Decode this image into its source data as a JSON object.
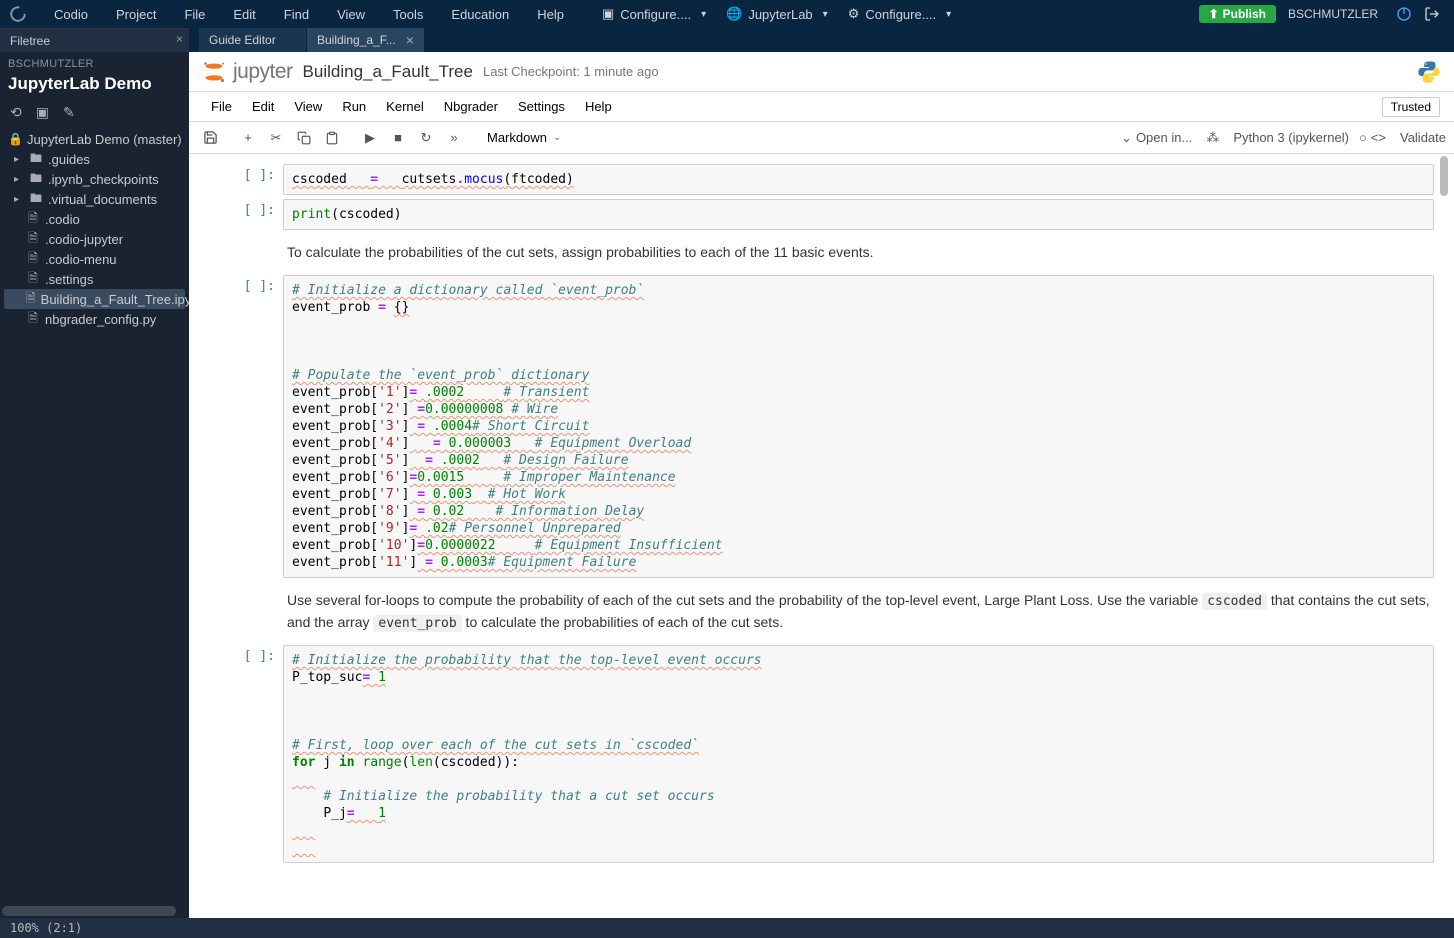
{
  "topbar": {
    "menus": [
      "Codio",
      "Project",
      "File",
      "Edit",
      "Find",
      "View",
      "Tools",
      "Education",
      "Help"
    ],
    "configs": [
      {
        "icon": "terminal",
        "label": "Configure...."
      },
      {
        "icon": "globe",
        "label": "JupyterLab"
      },
      {
        "icon": "gear",
        "label": "Configure...."
      }
    ],
    "publish": "Publish",
    "user": "BSCHMUTZLER"
  },
  "sidebar": {
    "tab": "Filetree",
    "user": "BSCHMUTZLER",
    "project": "JupyterLab Demo",
    "root": "JupyterLab Demo (master)",
    "items": [
      {
        "type": "folder",
        "name": ".guides"
      },
      {
        "type": "folder",
        "name": ".ipynb_checkpoints"
      },
      {
        "type": "folder",
        "name": ".virtual_documents"
      },
      {
        "type": "file",
        "name": ".codio"
      },
      {
        "type": "file",
        "name": ".codio-jupyter"
      },
      {
        "type": "file",
        "name": ".codio-menu"
      },
      {
        "type": "file",
        "name": ".settings"
      },
      {
        "type": "file",
        "name": "Building_a_Fault_Tree.ipynb",
        "active": true
      },
      {
        "type": "file",
        "name": "nbgrader_config.py"
      }
    ]
  },
  "tabs": [
    {
      "label": "Guide Editor",
      "active": false,
      "closeable": false
    },
    {
      "label": "Building_a_F...",
      "active": true,
      "closeable": true
    }
  ],
  "jupyter": {
    "logo_text": "jupyter",
    "notebook_name": "Building_a_Fault_Tree",
    "checkpoint": "Last Checkpoint: 1 minute ago",
    "menus": [
      "File",
      "Edit",
      "View",
      "Run",
      "Kernel",
      "Nbgrader",
      "Settings",
      "Help"
    ],
    "trusted": "Trusted",
    "cell_type": "Markdown",
    "open_in": "Open in...",
    "kernel": "Python 3 (ipykernel)",
    "validate": "Validate"
  },
  "cells": {
    "c1_code": "cscoded   =   cutsets.mocus(ftcoded)",
    "c2_code": "print(cscoded)",
    "md1": "To calculate the probabilities of the cut sets, assign probabilities to each of the 11 basic events.",
    "md2_pre": "Use several for-loops to compute the probability of each of the cut sets and the probability of the top-level event, Large Plant Loss. Use the variable ",
    "md2_code1": "cscoded",
    "md2_mid": " that contains the cut sets, and the array ",
    "md2_code2": "event_prob",
    "md2_post": " to calculate the probabilities of each of the cut sets.",
    "c3": {
      "comment1": "# Initialize a dictionary called `event_prob`",
      "line1": "event_prob = {}",
      "comment2": "# Populate the `event_prob` dictionary",
      "rows": [
        {
          "key": "'1'",
          "assign": "= .0002     ",
          "comment": "# Transient"
        },
        {
          "key": "'2'",
          "assign": " =0.00000008 ",
          "comment": "# Wire"
        },
        {
          "key": "'3'",
          "assign": " = .0004",
          "comment": "# Short Circuit"
        },
        {
          "key": "'4'",
          "assign": "   = 0.000003   ",
          "comment": "# Equipment Overload"
        },
        {
          "key": "'5'",
          "assign": "  = .0002   ",
          "comment": "# Design Failure"
        },
        {
          "key": "'6'",
          "assign": "=0.0015     ",
          "comment": "# Improper Maintenance"
        },
        {
          "key": "'7'",
          "assign": " = 0.003  ",
          "comment": "# Hot Work"
        },
        {
          "key": "'8'",
          "assign": " = 0.02    ",
          "comment": "# Information Delay"
        },
        {
          "key": "'9'",
          "assign": "= .02",
          "comment": "# Personnel Unprepared"
        },
        {
          "key": "'10'",
          "assign": "=0.0000022     ",
          "comment": "# Equipment Insufficient"
        },
        {
          "key": "'11'",
          "assign": " = 0.0003",
          "comment": "# Equipment Failure"
        }
      ]
    },
    "c4": {
      "comment1": "# Initialize the probability that the top-level event occurs",
      "line1": "P_top_suc= 1",
      "comment2": "# First, loop over each of the cut sets in `cscoded`",
      "forline": "for j in range(len(cscoded)):",
      "comment3": "# Initialize the probability that a cut set occurs",
      "line3": "P_j=   1"
    }
  },
  "statusbar": "100%  (2:1)"
}
